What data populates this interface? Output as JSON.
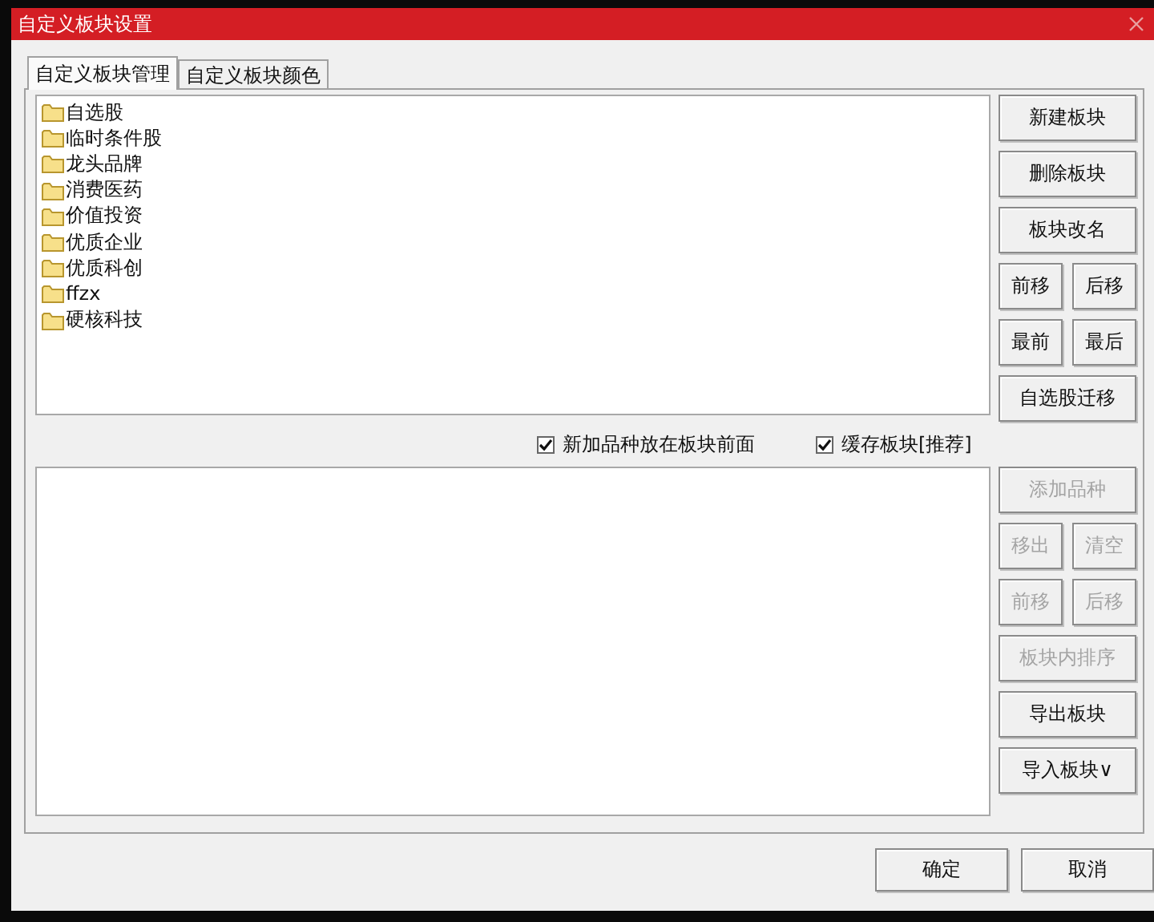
{
  "window": {
    "title": "自定义板块设置"
  },
  "tabs": [
    {
      "label": "自定义板块管理",
      "selected": true
    },
    {
      "label": "自定义板块颜色",
      "selected": false
    }
  ],
  "block_list": [
    "自选股",
    "临时条件股",
    "龙头品牌",
    "消费医药",
    "价值投资",
    "优质企业",
    "优质科创",
    "ffzx",
    "硬核科技"
  ],
  "block_buttons": [
    [
      {
        "label": "新建板块",
        "disabled": false
      }
    ],
    [
      {
        "label": "删除板块",
        "disabled": false
      }
    ],
    [
      {
        "label": "板块改名",
        "disabled": false
      }
    ],
    [
      {
        "label": "前移",
        "disabled": false
      },
      {
        "label": "后移",
        "disabled": false
      }
    ],
    [
      {
        "label": "最前",
        "disabled": false
      },
      {
        "label": "最后",
        "disabled": false
      }
    ],
    [
      {
        "label": "自选股迁移",
        "disabled": false
      }
    ]
  ],
  "options": [
    {
      "label": "新加品种放在板块前面",
      "checked": true
    },
    {
      "label": "缓存板块[推荐]",
      "checked": true
    }
  ],
  "stock_buttons": [
    [
      {
        "label": "添加品种",
        "disabled": true
      }
    ],
    [
      {
        "label": "移出",
        "disabled": true
      },
      {
        "label": "清空",
        "disabled": true
      }
    ],
    [
      {
        "label": "前移",
        "disabled": true
      },
      {
        "label": "后移",
        "disabled": true
      }
    ],
    [
      {
        "label": "板块内排序",
        "disabled": true
      }
    ],
    [
      {
        "label": "导出板块",
        "disabled": false
      }
    ],
    [
      {
        "label": "导入板块∨",
        "disabled": false
      }
    ]
  ],
  "footer_buttons": [
    "确定",
    "取消"
  ]
}
